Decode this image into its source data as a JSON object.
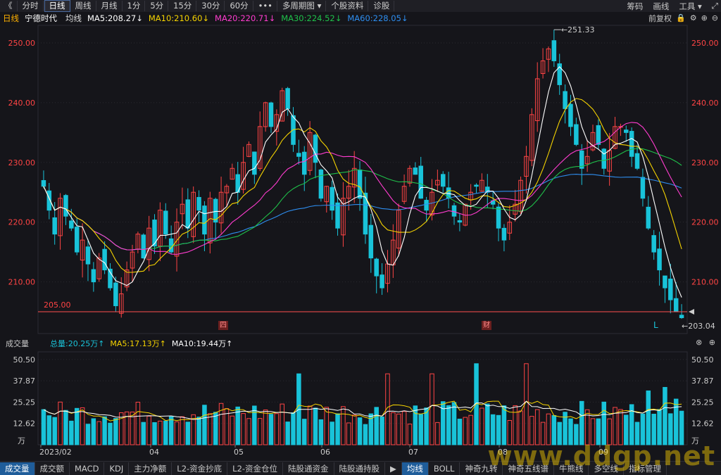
{
  "toolbar": {
    "items": [
      "《",
      "分时",
      "日线",
      "周线",
      "月线",
      "1分",
      "5分",
      "15分",
      "30分",
      "60分",
      "•••",
      "多周期图 ▾",
      "个股资料",
      "诊股"
    ],
    "active_index": 2,
    "right": [
      "筹码",
      "画线",
      "工具 ▾",
      "⤢"
    ]
  },
  "stock": {
    "period": "日线",
    "name": "宁德时代",
    "avg_label": "均线",
    "ma5": "MA5:208.27↓",
    "ma10": "MA10:210.60↓",
    "ma20": "MA20:220.71↓",
    "ma30": "MA30:224.52↓",
    "ma60": "MA60:228.05↓",
    "adjust": "前复权"
  },
  "colors": {
    "up": "#ff4444",
    "down": "#19c3d9",
    "ma5": "#ffffff",
    "ma10": "#f5d300",
    "ma20": "#ff3ccf",
    "ma30": "#1fc04a",
    "ma60": "#2e8ef0",
    "support": "#ff4f4f"
  },
  "price_axis": [
    "250.00",
    "240.00",
    "230.00",
    "220.00",
    "210.00"
  ],
  "annotations": {
    "high": "251.33",
    "low": "203.04",
    "support": "205.00",
    "marker_left": "四",
    "marker_mid": "财",
    "marker_right": "L"
  },
  "volume": {
    "header_label": "成交量",
    "total": "总量:20.25万↑",
    "ma5": "MA5:17.13万↑",
    "ma10": "MA10:19.44万↑",
    "axis": [
      "50.50",
      "37.87",
      "25.25",
      "12.62",
      "万"
    ],
    "months": [
      "2023/02",
      "04",
      "05",
      "06",
      "07",
      "08",
      "09"
    ]
  },
  "bottom_tabs": [
    "成交量",
    "成交额",
    "MACD",
    "KDJ",
    "主力净额",
    "L2-资金抄底",
    "L2-资金仓位",
    "陆股通资金",
    "陆股通持股",
    "▶",
    "均线",
    "BOLL",
    "神奇九转",
    "神奇五线谱",
    "牛熊线",
    "多空线",
    "指标管理"
  ],
  "bottom_selected": [
    0,
    10
  ],
  "watermark": "www.ddgp.net",
  "chart_data": {
    "type": "candlestick",
    "title": "宁德时代 日线",
    "ylim": [
      203,
      252
    ],
    "x_labels": [
      "2023/02",
      "04",
      "05",
      "06",
      "07",
      "08",
      "09"
    ],
    "close_series": [
      226,
      222,
      218,
      224,
      221,
      219,
      215,
      217,
      213,
      210,
      214,
      212,
      209,
      206,
      208,
      212,
      215,
      218,
      214,
      219,
      216,
      222,
      218,
      215,
      220,
      223,
      219,
      225,
      222,
      218,
      224,
      220,
      225,
      226,
      229,
      225,
      230,
      233,
      228,
      236,
      240,
      236,
      238,
      242,
      239,
      233,
      231,
      228,
      235,
      230,
      224,
      226,
      222,
      219,
      224,
      226,
      229,
      224,
      218,
      214,
      211,
      209,
      213,
      217,
      222,
      226,
      229,
      228,
      224,
      222,
      225,
      227,
      226,
      224,
      221,
      220,
      223,
      225,
      226,
      227,
      225,
      223,
      219,
      217,
      220,
      223,
      227,
      231,
      238,
      244,
      247,
      249,
      247,
      243,
      239,
      236,
      233,
      229,
      231,
      235,
      233,
      229,
      232,
      236,
      236,
      235,
      231,
      229,
      224,
      219,
      215,
      212,
      209,
      207,
      205,
      204
    ]
  }
}
